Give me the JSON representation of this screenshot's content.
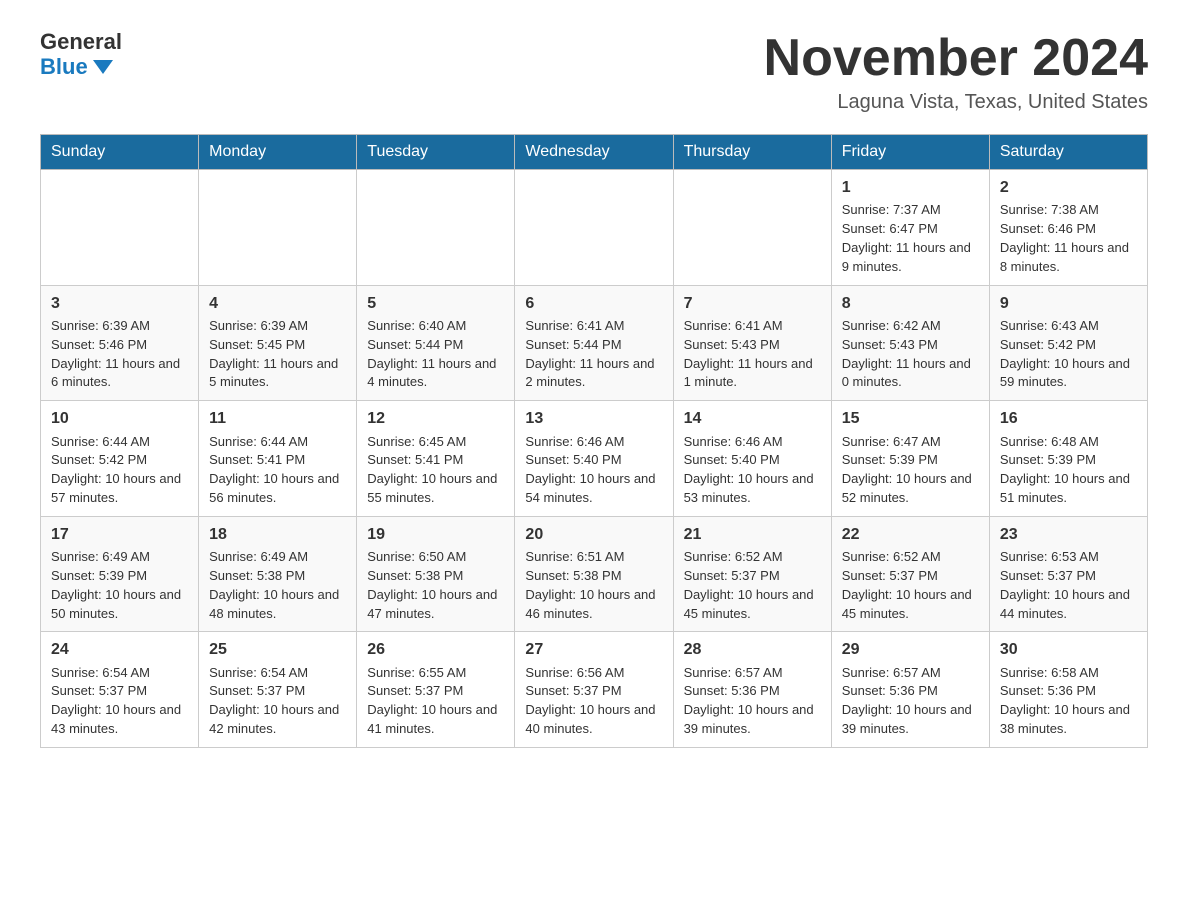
{
  "logo": {
    "general": "General",
    "blue": "Blue"
  },
  "title": "November 2024",
  "subtitle": "Laguna Vista, Texas, United States",
  "days_of_week": [
    "Sunday",
    "Monday",
    "Tuesday",
    "Wednesday",
    "Thursday",
    "Friday",
    "Saturday"
  ],
  "weeks": [
    [
      {
        "day": "",
        "sunrise": "",
        "sunset": "",
        "daylight": ""
      },
      {
        "day": "",
        "sunrise": "",
        "sunset": "",
        "daylight": ""
      },
      {
        "day": "",
        "sunrise": "",
        "sunset": "",
        "daylight": ""
      },
      {
        "day": "",
        "sunrise": "",
        "sunset": "",
        "daylight": ""
      },
      {
        "day": "",
        "sunrise": "",
        "sunset": "",
        "daylight": ""
      },
      {
        "day": "1",
        "sunrise": "Sunrise: 7:37 AM",
        "sunset": "Sunset: 6:47 PM",
        "daylight": "Daylight: 11 hours and 9 minutes."
      },
      {
        "day": "2",
        "sunrise": "Sunrise: 7:38 AM",
        "sunset": "Sunset: 6:46 PM",
        "daylight": "Daylight: 11 hours and 8 minutes."
      }
    ],
    [
      {
        "day": "3",
        "sunrise": "Sunrise: 6:39 AM",
        "sunset": "Sunset: 5:46 PM",
        "daylight": "Daylight: 11 hours and 6 minutes."
      },
      {
        "day": "4",
        "sunrise": "Sunrise: 6:39 AM",
        "sunset": "Sunset: 5:45 PM",
        "daylight": "Daylight: 11 hours and 5 minutes."
      },
      {
        "day": "5",
        "sunrise": "Sunrise: 6:40 AM",
        "sunset": "Sunset: 5:44 PM",
        "daylight": "Daylight: 11 hours and 4 minutes."
      },
      {
        "day": "6",
        "sunrise": "Sunrise: 6:41 AM",
        "sunset": "Sunset: 5:44 PM",
        "daylight": "Daylight: 11 hours and 2 minutes."
      },
      {
        "day": "7",
        "sunrise": "Sunrise: 6:41 AM",
        "sunset": "Sunset: 5:43 PM",
        "daylight": "Daylight: 11 hours and 1 minute."
      },
      {
        "day": "8",
        "sunrise": "Sunrise: 6:42 AM",
        "sunset": "Sunset: 5:43 PM",
        "daylight": "Daylight: 11 hours and 0 minutes."
      },
      {
        "day": "9",
        "sunrise": "Sunrise: 6:43 AM",
        "sunset": "Sunset: 5:42 PM",
        "daylight": "Daylight: 10 hours and 59 minutes."
      }
    ],
    [
      {
        "day": "10",
        "sunrise": "Sunrise: 6:44 AM",
        "sunset": "Sunset: 5:42 PM",
        "daylight": "Daylight: 10 hours and 57 minutes."
      },
      {
        "day": "11",
        "sunrise": "Sunrise: 6:44 AM",
        "sunset": "Sunset: 5:41 PM",
        "daylight": "Daylight: 10 hours and 56 minutes."
      },
      {
        "day": "12",
        "sunrise": "Sunrise: 6:45 AM",
        "sunset": "Sunset: 5:41 PM",
        "daylight": "Daylight: 10 hours and 55 minutes."
      },
      {
        "day": "13",
        "sunrise": "Sunrise: 6:46 AM",
        "sunset": "Sunset: 5:40 PM",
        "daylight": "Daylight: 10 hours and 54 minutes."
      },
      {
        "day": "14",
        "sunrise": "Sunrise: 6:46 AM",
        "sunset": "Sunset: 5:40 PM",
        "daylight": "Daylight: 10 hours and 53 minutes."
      },
      {
        "day": "15",
        "sunrise": "Sunrise: 6:47 AM",
        "sunset": "Sunset: 5:39 PM",
        "daylight": "Daylight: 10 hours and 52 minutes."
      },
      {
        "day": "16",
        "sunrise": "Sunrise: 6:48 AM",
        "sunset": "Sunset: 5:39 PM",
        "daylight": "Daylight: 10 hours and 51 minutes."
      }
    ],
    [
      {
        "day": "17",
        "sunrise": "Sunrise: 6:49 AM",
        "sunset": "Sunset: 5:39 PM",
        "daylight": "Daylight: 10 hours and 50 minutes."
      },
      {
        "day": "18",
        "sunrise": "Sunrise: 6:49 AM",
        "sunset": "Sunset: 5:38 PM",
        "daylight": "Daylight: 10 hours and 48 minutes."
      },
      {
        "day": "19",
        "sunrise": "Sunrise: 6:50 AM",
        "sunset": "Sunset: 5:38 PM",
        "daylight": "Daylight: 10 hours and 47 minutes."
      },
      {
        "day": "20",
        "sunrise": "Sunrise: 6:51 AM",
        "sunset": "Sunset: 5:38 PM",
        "daylight": "Daylight: 10 hours and 46 minutes."
      },
      {
        "day": "21",
        "sunrise": "Sunrise: 6:52 AM",
        "sunset": "Sunset: 5:37 PM",
        "daylight": "Daylight: 10 hours and 45 minutes."
      },
      {
        "day": "22",
        "sunrise": "Sunrise: 6:52 AM",
        "sunset": "Sunset: 5:37 PM",
        "daylight": "Daylight: 10 hours and 45 minutes."
      },
      {
        "day": "23",
        "sunrise": "Sunrise: 6:53 AM",
        "sunset": "Sunset: 5:37 PM",
        "daylight": "Daylight: 10 hours and 44 minutes."
      }
    ],
    [
      {
        "day": "24",
        "sunrise": "Sunrise: 6:54 AM",
        "sunset": "Sunset: 5:37 PM",
        "daylight": "Daylight: 10 hours and 43 minutes."
      },
      {
        "day": "25",
        "sunrise": "Sunrise: 6:54 AM",
        "sunset": "Sunset: 5:37 PM",
        "daylight": "Daylight: 10 hours and 42 minutes."
      },
      {
        "day": "26",
        "sunrise": "Sunrise: 6:55 AM",
        "sunset": "Sunset: 5:37 PM",
        "daylight": "Daylight: 10 hours and 41 minutes."
      },
      {
        "day": "27",
        "sunrise": "Sunrise: 6:56 AM",
        "sunset": "Sunset: 5:37 PM",
        "daylight": "Daylight: 10 hours and 40 minutes."
      },
      {
        "day": "28",
        "sunrise": "Sunrise: 6:57 AM",
        "sunset": "Sunset: 5:36 PM",
        "daylight": "Daylight: 10 hours and 39 minutes."
      },
      {
        "day": "29",
        "sunrise": "Sunrise: 6:57 AM",
        "sunset": "Sunset: 5:36 PM",
        "daylight": "Daylight: 10 hours and 39 minutes."
      },
      {
        "day": "30",
        "sunrise": "Sunrise: 6:58 AM",
        "sunset": "Sunset: 5:36 PM",
        "daylight": "Daylight: 10 hours and 38 minutes."
      }
    ]
  ]
}
